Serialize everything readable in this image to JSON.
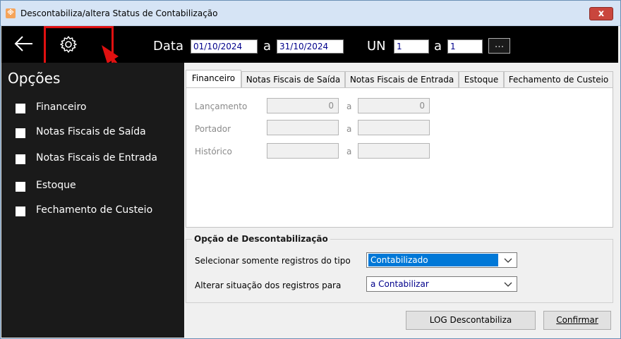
{
  "window": {
    "title": "Descontabiliza/altera Status de Contabilização",
    "close_label": "x"
  },
  "toolbar": {
    "data_label": "Data",
    "date_from": "01/10/2024",
    "a_label": "a",
    "date_to": "31/10/2024",
    "un_label": "UN",
    "un_from": "1",
    "un_to": "1",
    "ellipsis_label": "..."
  },
  "sidebar": {
    "title": "Opções",
    "items": [
      {
        "label": "Financeiro"
      },
      {
        "label": "Notas Fiscais de Saída"
      },
      {
        "label": "Notas Fiscais de Entrada"
      },
      {
        "label": "Estoque"
      },
      {
        "label": "Fechamento de Custeio"
      }
    ]
  },
  "tabs": [
    {
      "label": "Financeiro"
    },
    {
      "label": "Notas Fiscais de Saída"
    },
    {
      "label": "Notas Fiscais de Entrada"
    },
    {
      "label": "Estoque"
    },
    {
      "label": "Fechamento de Custeio"
    }
  ],
  "financeiro": {
    "lancamento_label": "Lançamento",
    "lancamento_from": "0",
    "lancamento_to": "0",
    "portador_label": "Portador",
    "portador_from": "",
    "portador_to": "",
    "historico_label": "Histórico",
    "historico_from": "",
    "historico_to": "",
    "a_label": "a"
  },
  "opcao": {
    "title": "Opção de Descontabilização",
    "selecionar_label": "Selecionar somente registros do tipo",
    "selecionar_value": "Contabilizado",
    "alterar_label": "Alterar situação dos registros para",
    "alterar_value": "a Contabilizar"
  },
  "buttons": {
    "log_label": "LOG Descontabiliza",
    "confirmar_label": "Confirmar"
  },
  "colors": {
    "toolbar_bg": "#000000",
    "sidebar_bg": "#1a1a1a",
    "highlight": "#e01010",
    "selection": "#0078d7"
  }
}
